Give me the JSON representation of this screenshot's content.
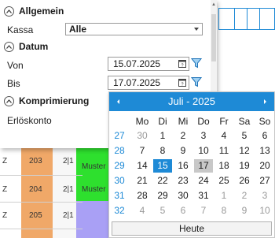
{
  "filter": {
    "allgemein": "Allgemein",
    "kassa_label": "Kassa",
    "kassa_value": "Alle",
    "datum": "Datum",
    "von_label": "Von",
    "von_value": "15.07.2025",
    "bis_label": "Bis",
    "bis_value": "17.07.2025",
    "komprimierung": "Komprimierung",
    "erloeskonto_label": "Erlöskonto"
  },
  "calendar": {
    "month_label": "Juli - 2025",
    "weekdays": [
      "Mo",
      "Di",
      "Mi",
      "Do",
      "Fr",
      "Sa",
      "So"
    ],
    "weeks": [
      {
        "wk": "27",
        "days": [
          "30",
          "1",
          "2",
          "3",
          "4",
          "5",
          "6"
        ]
      },
      {
        "wk": "28",
        "days": [
          "7",
          "8",
          "9",
          "10",
          "11",
          "12",
          "13"
        ]
      },
      {
        "wk": "29",
        "days": [
          "14",
          "15",
          "16",
          "17",
          "18",
          "19",
          "20"
        ]
      },
      {
        "wk": "30",
        "days": [
          "21",
          "22",
          "23",
          "24",
          "25",
          "26",
          "27"
        ]
      },
      {
        "wk": "31",
        "days": [
          "28",
          "29",
          "30",
          "31",
          "1",
          "2",
          "3"
        ]
      },
      {
        "wk": "32",
        "days": [
          "4",
          "5",
          "6",
          "7",
          "8",
          "9",
          "10"
        ]
      }
    ],
    "today_label": "Heute",
    "today_day": "15",
    "selected_day": "17"
  },
  "table": {
    "rows": [
      {
        "col1": "Z",
        "col2": "203",
        "col3": "2|1",
        "col4": "Muster"
      },
      {
        "col1": "Z",
        "col2": "204",
        "col3": "2|1",
        "col4": "Muster"
      },
      {
        "col1": "Z",
        "col2": "205",
        "col3": "2|1",
        "col4": ""
      }
    ]
  },
  "colors": {
    "accent": "#1e8ad6",
    "orange": "#f0a868",
    "green": "#2ee02e",
    "purple": "#a9a0f5"
  }
}
